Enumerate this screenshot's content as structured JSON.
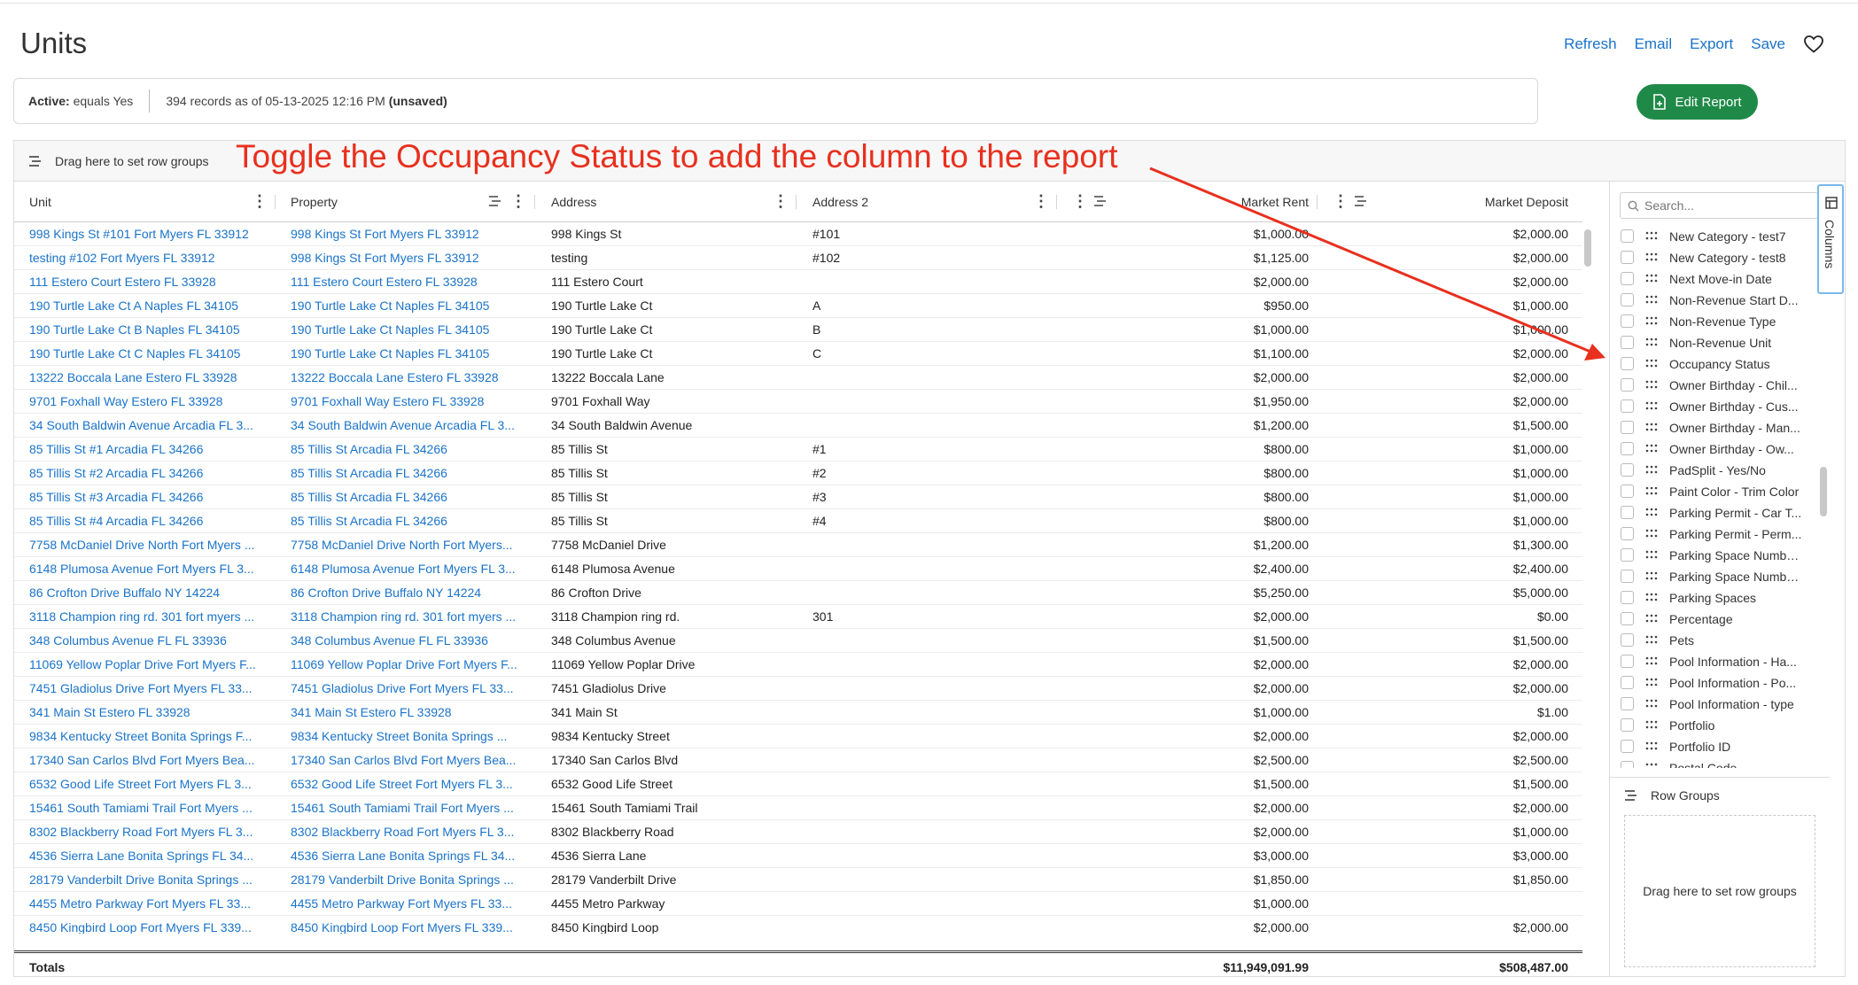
{
  "page": {
    "title": "Units",
    "actions": [
      "Refresh",
      "Email",
      "Export",
      "Save"
    ]
  },
  "filter": {
    "label": "Active:",
    "condition": "equals Yes",
    "records": "394 records as of 05-13-2025 12:16 PM",
    "status": "(unsaved)"
  },
  "edit_report_label": "Edit Report",
  "group_bar_label": "Drag here to set row groups",
  "annotation_text": "Toggle the Occupancy Status to add the column to the report",
  "columns": {
    "unit": "Unit",
    "property": "Property",
    "address": "Address",
    "address2": "Address 2",
    "market_rent": "Market Rent",
    "market_deposit": "Market Deposit"
  },
  "rows": [
    {
      "unit": "998 Kings St #101 Fort Myers FL 33912",
      "property": "998 Kings St Fort Myers FL 33912",
      "address": "998 Kings St",
      "address2": "#101",
      "rent": "$1,000.00",
      "deposit": "$2,000.00"
    },
    {
      "unit": "testing #102 Fort Myers FL 33912",
      "property": "998 Kings St Fort Myers FL 33912",
      "address": "testing",
      "address2": "#102",
      "rent": "$1,125.00",
      "deposit": "$2,000.00"
    },
    {
      "unit": "111 Estero Court Estero FL 33928",
      "property": "111 Estero Court Estero FL 33928",
      "address": "111 Estero Court",
      "address2": "",
      "rent": "$2,000.00",
      "deposit": "$2,000.00"
    },
    {
      "unit": "190 Turtle Lake Ct A Naples FL 34105",
      "property": "190 Turtle Lake Ct Naples FL 34105",
      "address": "190 Turtle Lake Ct",
      "address2": "A",
      "rent": "$950.00",
      "deposit": "$1,000.00"
    },
    {
      "unit": "190 Turtle Lake Ct B Naples FL 34105",
      "property": "190 Turtle Lake Ct Naples FL 34105",
      "address": "190 Turtle Lake Ct",
      "address2": "B",
      "rent": "$1,000.00",
      "deposit": "$1,000.00"
    },
    {
      "unit": "190 Turtle Lake Ct C Naples FL 34105",
      "property": "190 Turtle Lake Ct Naples FL 34105",
      "address": "190 Turtle Lake Ct",
      "address2": "C",
      "rent": "$1,100.00",
      "deposit": "$2,000.00"
    },
    {
      "unit": "13222 Boccala Lane Estero FL 33928",
      "property": "13222 Boccala Lane Estero FL 33928",
      "address": "13222 Boccala Lane",
      "address2": "",
      "rent": "$2,000.00",
      "deposit": "$2,000.00"
    },
    {
      "unit": "9701 Foxhall Way Estero FL 33928",
      "property": "9701 Foxhall Way Estero FL 33928",
      "address": "9701 Foxhall Way",
      "address2": "",
      "rent": "$1,950.00",
      "deposit": "$2,000.00"
    },
    {
      "unit": "34 South Baldwin Avenue Arcadia FL 3...",
      "property": "34 South Baldwin Avenue Arcadia FL 3...",
      "address": "34 South Baldwin Avenue",
      "address2": "",
      "rent": "$1,200.00",
      "deposit": "$1,500.00"
    },
    {
      "unit": "85 Tillis St #1 Arcadia FL 34266",
      "property": "85 Tillis St Arcadia FL 34266",
      "address": "85 Tillis St",
      "address2": "#1",
      "rent": "$800.00",
      "deposit": "$1,000.00"
    },
    {
      "unit": "85 Tillis St #2 Arcadia FL 34266",
      "property": "85 Tillis St Arcadia FL 34266",
      "address": "85 Tillis St",
      "address2": "#2",
      "rent": "$800.00",
      "deposit": "$1,000.00"
    },
    {
      "unit": "85 Tillis St #3 Arcadia FL 34266",
      "property": "85 Tillis St Arcadia FL 34266",
      "address": "85 Tillis St",
      "address2": "#3",
      "rent": "$800.00",
      "deposit": "$1,000.00"
    },
    {
      "unit": "85 Tillis St #4 Arcadia FL 34266",
      "property": "85 Tillis St Arcadia FL 34266",
      "address": "85 Tillis St",
      "address2": "#4",
      "rent": "$800.00",
      "deposit": "$1,000.00"
    },
    {
      "unit": "7758 McDaniel Drive North Fort Myers ...",
      "property": "7758 McDaniel Drive North Fort Myers...",
      "address": "7758 McDaniel Drive",
      "address2": "",
      "rent": "$1,200.00",
      "deposit": "$1,300.00"
    },
    {
      "unit": "6148 Plumosa Avenue Fort Myers FL 3...",
      "property": "6148 Plumosa Avenue Fort Myers FL 3...",
      "address": "6148 Plumosa Avenue",
      "address2": "",
      "rent": "$2,400.00",
      "deposit": "$2,400.00"
    },
    {
      "unit": "86 Crofton Drive Buffalo NY 14224",
      "property": "86 Crofton Drive Buffalo NY 14224",
      "address": "86 Crofton Drive",
      "address2": "",
      "rent": "$5,250.00",
      "deposit": "$5,000.00"
    },
    {
      "unit": "3118 Champion ring rd. 301 fort myers ...",
      "property": "3118 Champion ring rd. 301 fort myers ...",
      "address": "3118 Champion ring rd.",
      "address2": "301",
      "rent": "$2,000.00",
      "deposit": "$0.00"
    },
    {
      "unit": "348 Columbus Avenue FL FL 33936",
      "property": "348 Columbus Avenue FL FL 33936",
      "address": "348 Columbus Avenue",
      "address2": "",
      "rent": "$1,500.00",
      "deposit": "$1,500.00"
    },
    {
      "unit": "11069 Yellow Poplar Drive Fort Myers F...",
      "property": "11069 Yellow Poplar Drive Fort Myers F...",
      "address": "11069 Yellow Poplar Drive",
      "address2": "",
      "rent": "$2,000.00",
      "deposit": "$2,000.00"
    },
    {
      "unit": "7451 Gladiolus Drive Fort Myers FL 33...",
      "property": "7451 Gladiolus Drive Fort Myers FL 33...",
      "address": "7451 Gladiolus Drive",
      "address2": "",
      "rent": "$2,000.00",
      "deposit": "$2,000.00"
    },
    {
      "unit": "341 Main St Estero FL 33928",
      "property": "341 Main St Estero FL 33928",
      "address": "341 Main St",
      "address2": "",
      "rent": "$1,000.00",
      "deposit": "$1.00"
    },
    {
      "unit": "9834 Kentucky Street Bonita Springs F...",
      "property": "9834 Kentucky Street Bonita Springs ...",
      "address": "9834 Kentucky Street",
      "address2": "",
      "rent": "$2,000.00",
      "deposit": "$2,000.00"
    },
    {
      "unit": "17340 San Carlos Blvd Fort Myers Bea...",
      "property": "17340 San Carlos Blvd Fort Myers Bea...",
      "address": "17340 San Carlos Blvd",
      "address2": "",
      "rent": "$2,500.00",
      "deposit": "$2,500.00"
    },
    {
      "unit": "6532 Good Life Street Fort Myers FL 3...",
      "property": "6532 Good Life Street Fort Myers FL 3...",
      "address": "6532 Good Life Street",
      "address2": "",
      "rent": "$1,500.00",
      "deposit": "$1,500.00"
    },
    {
      "unit": "15461 South Tamiami Trail Fort Myers ...",
      "property": "15461 South Tamiami Trail Fort Myers ...",
      "address": "15461 South Tamiami Trail",
      "address2": "",
      "rent": "$2,000.00",
      "deposit": "$2,000.00"
    },
    {
      "unit": "8302 Blackberry Road Fort Myers FL 3...",
      "property": "8302 Blackberry Road Fort Myers FL 3...",
      "address": "8302 Blackberry Road",
      "address2": "",
      "rent": "$2,000.00",
      "deposit": "$1,000.00"
    },
    {
      "unit": "4536 Sierra Lane Bonita Springs FL 34...",
      "property": "4536 Sierra Lane Bonita Springs FL 34...",
      "address": "4536 Sierra Lane",
      "address2": "",
      "rent": "$3,000.00",
      "deposit": "$3,000.00"
    },
    {
      "unit": "28179 Vanderbilt Drive Bonita Springs ...",
      "property": "28179 Vanderbilt Drive Bonita Springs ...",
      "address": "28179 Vanderbilt Drive",
      "address2": "",
      "rent": "$1,850.00",
      "deposit": "$1,850.00"
    },
    {
      "unit": "4455 Metro Parkway Fort Myers FL 33...",
      "property": "4455 Metro Parkway Fort Myers FL 33...",
      "address": "4455 Metro Parkway",
      "address2": "",
      "rent": "$1,000.00",
      "deposit": ""
    },
    {
      "unit": "8450 Kingbird Loop Fort Myers FL 339...",
      "property": "8450 Kingbird Loop Fort Myers FL 339...",
      "address": "8450 Kingbird Loop",
      "address2": "",
      "rent": "$2,000.00",
      "deposit": "$2,000.00"
    }
  ],
  "totals": {
    "label": "Totals",
    "market_rent": "$11,949,091.99",
    "market_deposit": "$508,487.00"
  },
  "side_panel": {
    "search_placeholder": "Search...",
    "columns_tab_label": "Columns",
    "column_items": [
      "New Category - test7",
      "New Category - test8",
      "Next Move-in Date",
      "Non-Revenue Start D...",
      "Non-Revenue Type",
      "Non-Revenue Unit",
      "Occupancy Status",
      "Owner Birthday - Chil...",
      "Owner Birthday - Cus...",
      "Owner Birthday - Man...",
      "Owner Birthday - Ow...",
      "PadSplit - Yes/No",
      "Paint Color - Trim Color",
      "Parking Permit - Car T...",
      "Parking Permit - Perm...",
      "Parking Space Numbe...",
      "Parking Space Numbe...",
      "Parking Spaces",
      "Percentage",
      "Pets",
      "Pool Information - Ha...",
      "Pool Information - Po...",
      "Pool Information - type",
      "Portfolio",
      "Portfolio ID",
      "Postal Code"
    ],
    "row_groups_title": "Row Groups",
    "row_groups_drop": "Drag here to set row groups"
  },
  "colors": {
    "link": "#1a73c8",
    "primary_button": "#1f8a48",
    "annotation": "#e8301e"
  }
}
